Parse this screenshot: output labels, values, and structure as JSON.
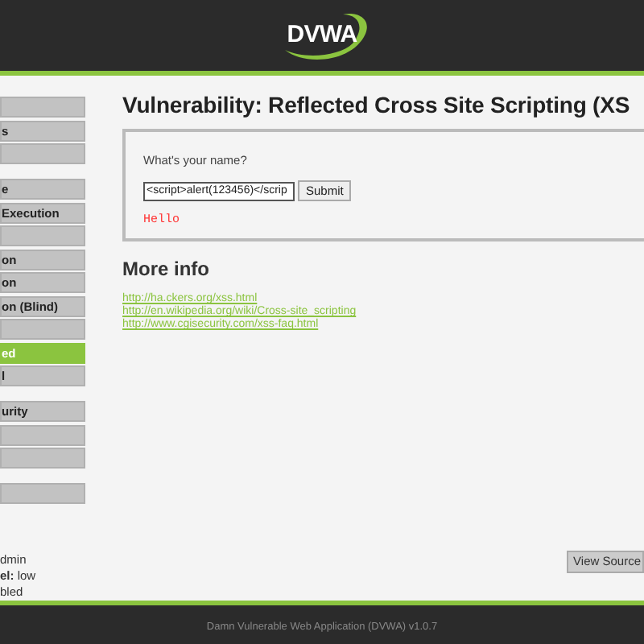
{
  "header": {
    "logo": "DVWA"
  },
  "menu_groups": [
    {
      "items": [
        {
          "selected": false
        },
        {
          "label": "s",
          "selected": false
        },
        {
          "selected": false
        }
      ]
    },
    {
      "items": [
        {
          "label": "e",
          "selected": false
        },
        {
          "label": "Execution",
          "selected": false
        },
        {
          "selected": false
        },
        {
          "label": "on",
          "selected": false
        },
        {
          "label": "on",
          "selected": false
        },
        {
          "label": "on (Blind)",
          "selected": false
        },
        {
          "selected": false
        },
        {
          "label": "ed",
          "selected": true
        },
        {
          "label": "l",
          "selected": false
        }
      ]
    },
    {
      "items": [
        {
          "label": "urity",
          "selected": false
        },
        {
          "selected": false
        },
        {
          "selected": false
        }
      ]
    },
    {
      "items": [
        {
          "selected": false
        }
      ]
    }
  ],
  "user_info": [
    "dmin",
    "**el:** low",
    "bled"
  ],
  "title": "Vulnerability: Reflected Cross Site Scripting (XS",
  "form": {
    "prompt": "What's your name?",
    "value": "<script>alert(123456)</scrip",
    "button": "Submit",
    "output": "Hello"
  },
  "more_info": {
    "heading": "More info",
    "links": [
      "http://ha.ckers.org/xss.html",
      "http://en.wikipedia.org/wiki/Cross-site_scripting",
      "http://www.cgisecurity.com/xss-faq.html"
    ]
  },
  "view_source": "View Source",
  "footer": "Damn Vulnerable Web Application (DVWA) v1.0.7"
}
